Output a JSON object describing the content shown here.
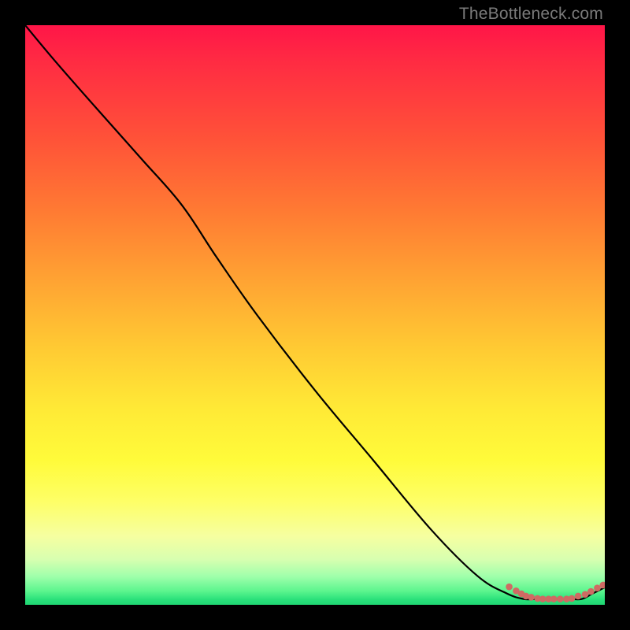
{
  "watermark": "TheBottleneck.com",
  "colors": {
    "background": "#000000",
    "curve": "#000000",
    "point": "#cf6a63",
    "gradient_top": "#ff1548",
    "gradient_bottom": "#1fd673"
  },
  "chart_data": {
    "type": "line",
    "title": "",
    "xlabel": "",
    "ylabel": "",
    "xlim": [
      0,
      100
    ],
    "ylim": [
      0,
      100
    ],
    "grid": false,
    "curve": {
      "name": "bottleneck-curve",
      "x": [
        0,
        5,
        12,
        20,
        27,
        33,
        40,
        50,
        60,
        70,
        78,
        83,
        86,
        88,
        90,
        92,
        94,
        96,
        98,
        100
      ],
      "y": [
        100,
        94,
        86,
        77,
        69,
        60,
        50,
        37,
        25,
        13,
        5,
        2,
        1,
        1,
        1,
        1,
        1,
        1,
        2,
        3
      ]
    },
    "points_cluster": {
      "name": "highlighted-points",
      "x": [
        83.5,
        84.7,
        85.6,
        86.4,
        87.3,
        88.4,
        89.3,
        90.3,
        91.2,
        92.3,
        93.4,
        94.3,
        95.4,
        96.6,
        97.6,
        98.7,
        99.7
      ],
      "y": [
        3.1,
        2.4,
        1.9,
        1.5,
        1.3,
        1.1,
        1.0,
        1.0,
        1.0,
        1.0,
        1.0,
        1.1,
        1.5,
        1.8,
        2.3,
        2.9,
        3.4
      ]
    }
  }
}
